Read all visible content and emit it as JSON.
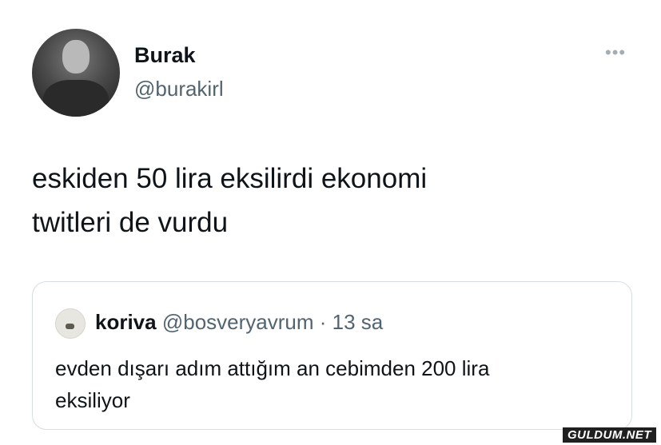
{
  "author": {
    "name": "Burak",
    "handle": "@burakirl"
  },
  "tweet": {
    "line1": "eskiden 50 lira eksilirdi ekonomi",
    "line2": "twitleri de vurdu"
  },
  "more_icon": "ellipsis-icon",
  "quoted": {
    "name": "koriva",
    "handle": "@bosveryavrum",
    "separator": " · ",
    "time": "13 sa",
    "line1": "evden dışarı adım attığım an cebimden 200 lira",
    "line2": "eksiliyor"
  },
  "watermark": "GULDUM.NET"
}
